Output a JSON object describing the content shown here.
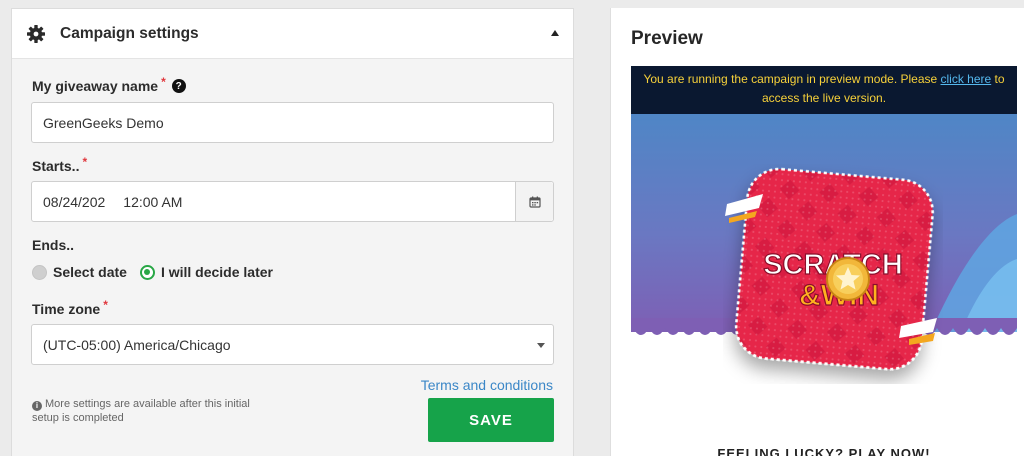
{
  "campaign": {
    "header_title": "Campaign settings",
    "giveaway_label": "My giveaway name",
    "giveaway_value": "GreenGeeks Demo",
    "starts_label": "Starts..",
    "starts_date": "08/24/202",
    "starts_time": "12:00 AM",
    "ends_label": "Ends..",
    "ends_options": [
      "Select date",
      "I will decide later"
    ],
    "ends_selected": "I will decide later",
    "timezone_label": "Time zone",
    "timezone_value": "(UTC-05:00) America/Chicago",
    "terms_link": "Terms and conditions",
    "info_note": "More settings are available after this initial setup is completed",
    "save_label": "SAVE",
    "required_mark": "*",
    "help_glyph": "?",
    "info_glyph": "i"
  },
  "preview": {
    "title": "Preview",
    "notice_before": "You are running the campaign in preview mode. Please ",
    "notice_link": "click here",
    "notice_after": " to access the live version.",
    "card_line1": "SCRATCH",
    "card_line2": "&WIN",
    "bottom_text": "FEELING LUCKY? PLAY NOW!"
  },
  "icons": {
    "header": "gear-icon",
    "collapse": "caret-up-icon",
    "help": "question-circle-icon",
    "calendar": "calendar-icon",
    "select": "chevron-down-icon",
    "info": "info-circle-icon",
    "coin": "star-coin-icon"
  },
  "colors": {
    "accent_green": "#16a34a",
    "link_blue": "#3b87c7",
    "required_red": "#e0383e",
    "notice_bg": "#0a1830",
    "notice_text": "#f7d13a",
    "card_red": "#e6264a"
  }
}
